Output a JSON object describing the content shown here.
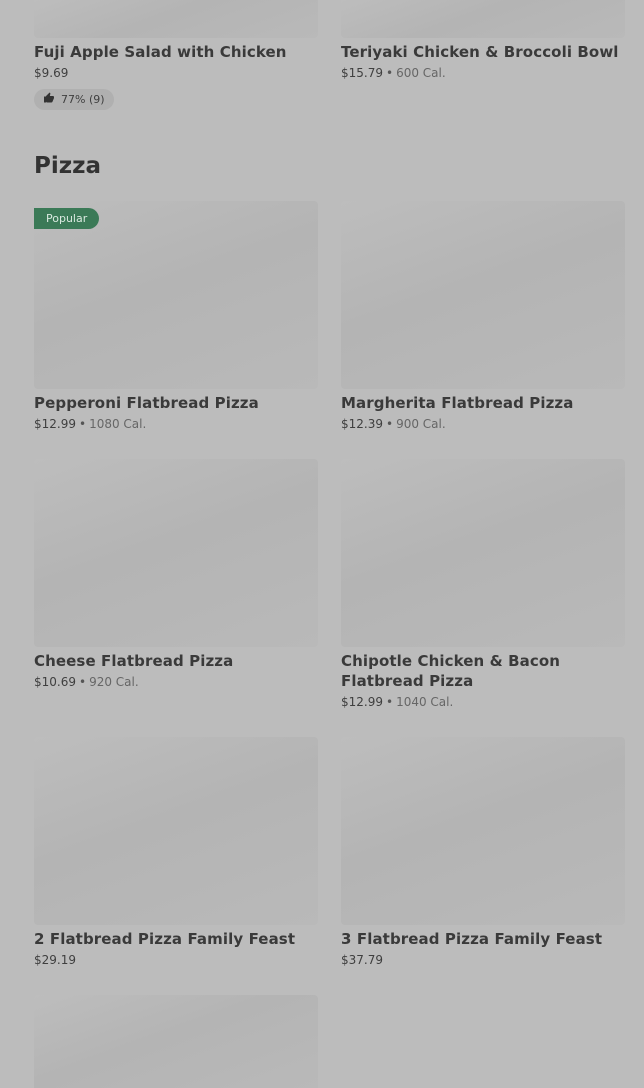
{
  "top_items": [
    {
      "name": "Fuji Apple Salad with Chicken",
      "price": "$9.69",
      "rating_icon": "thumbs-up-icon",
      "rating": "77% (9)"
    },
    {
      "name": "Teriyaki Chicken & Broccoli Bowl",
      "price": "$15.79",
      "separator": "•",
      "calories": "600 Cal."
    }
  ],
  "section": {
    "title": "Pizza"
  },
  "badge": {
    "label": "Popular",
    "color": "#3b7a57"
  },
  "items": [
    {
      "name": "Pepperoni Flatbread Pizza",
      "price": "$12.99",
      "separator": "•",
      "calories": "1080 Cal."
    },
    {
      "name": "Margherita Flatbread Pizza",
      "price": "$12.39",
      "separator": "•",
      "calories": "900 Cal."
    },
    {
      "name": "Cheese Flatbread Pizza",
      "price": "$10.69",
      "separator": "•",
      "calories": "920 Cal."
    },
    {
      "name": "Chipotle Chicken & Bacon Flatbread Pizza",
      "price": "$12.99",
      "separator": "•",
      "calories": "1040 Cal."
    },
    {
      "name": "2 Flatbread Pizza Family Feast",
      "price": "$29.19"
    },
    {
      "name": "3 Flatbread Pizza Family Feast",
      "price": "$37.79"
    }
  ]
}
